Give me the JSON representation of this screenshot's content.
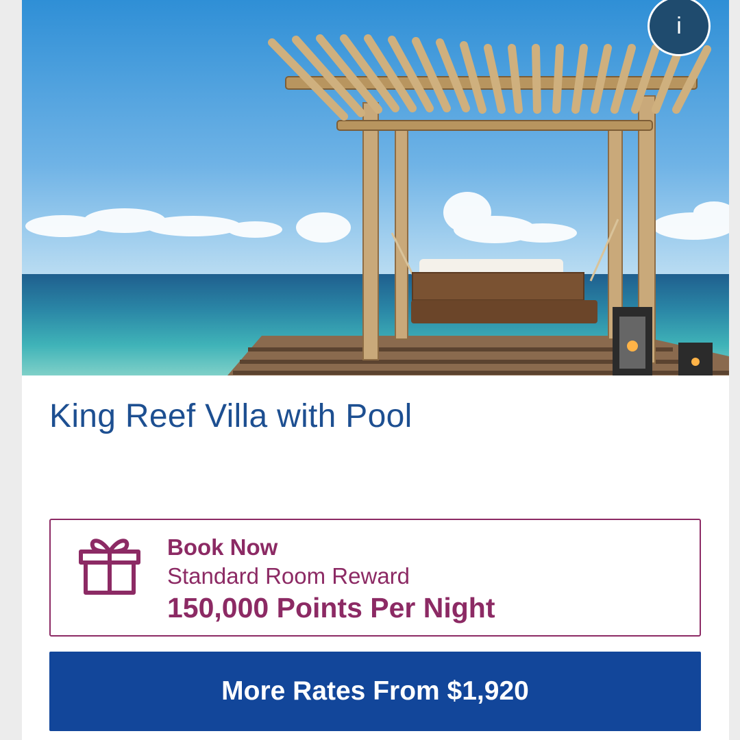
{
  "hero": {
    "image_alt": "Overwater deck with pergola swing bed facing the ocean",
    "info_label": "i"
  },
  "room": {
    "title": "King Reef Villa with Pool"
  },
  "reward": {
    "icon": "gift-icon",
    "cta": "Book Now",
    "type": "Standard Room Reward",
    "points": "150,000 Points Per Night"
  },
  "rates_button": {
    "label": "More Rates From $1,920"
  },
  "colors": {
    "title_blue": "#1d4f91",
    "reward_plum": "#8c2a64",
    "button_blue": "#12469a",
    "info_navy": "#1f4b6e"
  }
}
